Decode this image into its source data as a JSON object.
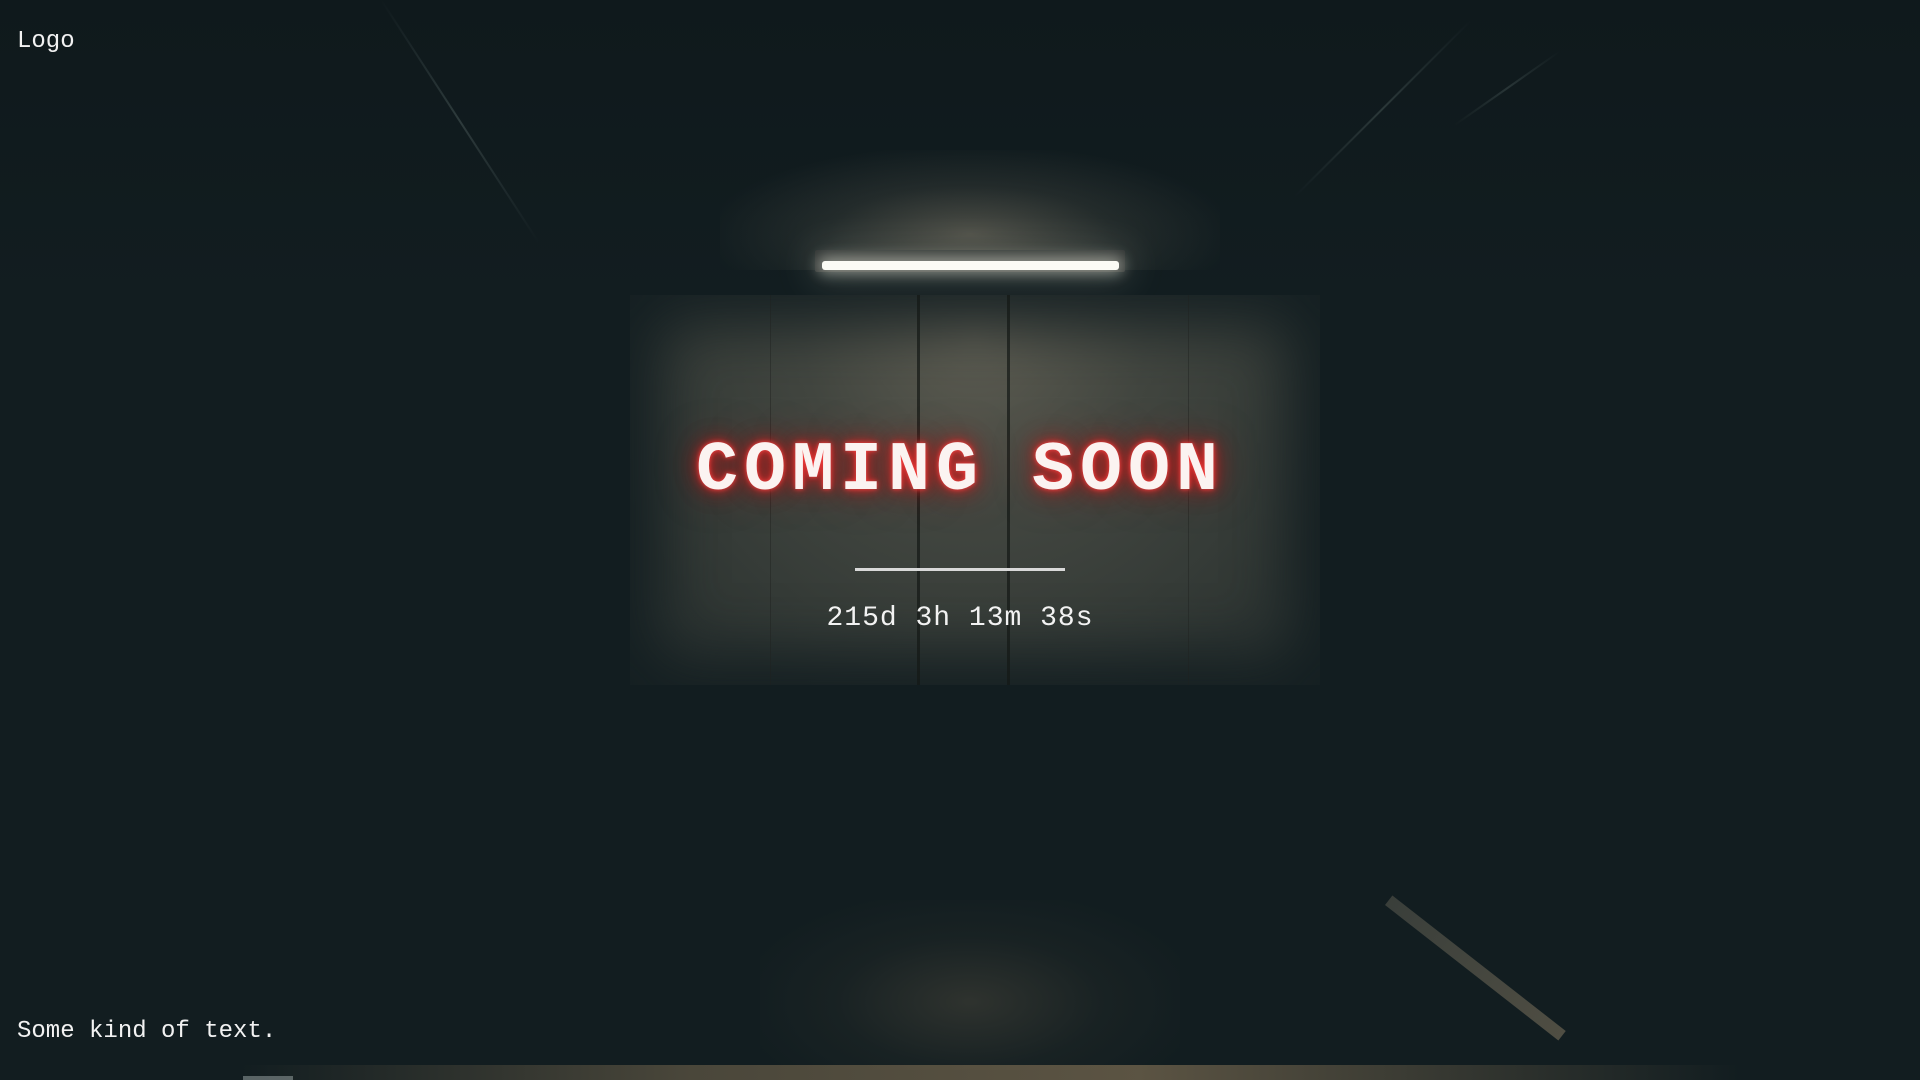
{
  "header": {
    "logo_text": "Logo"
  },
  "hero": {
    "headline": "COMING SOON",
    "countdown": "215d 3h 13m 38s"
  },
  "footer": {
    "text": "Some kind of text."
  },
  "colors": {
    "background": "#121d20",
    "text": "#f2f2f2",
    "headline_glow": "#e02828",
    "divider": "#d9d9d9"
  }
}
